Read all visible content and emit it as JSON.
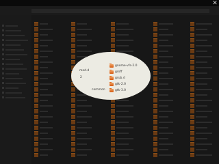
{
  "window": {
    "close_glyph": "✕"
  },
  "spotlight": {
    "folders": [
      {
        "label": "gnome-vfs-2.0"
      },
      {
        "label": "groff"
      },
      {
        "label": "grub.d"
      },
      {
        "label": "gtk-2.0"
      },
      {
        "label": "gtk-3.0"
      }
    ],
    "left_fragments": [
      "mod.d",
      "2",
      "common"
    ]
  },
  "colors": {
    "background": "#141414",
    "spotlight": "#ecebe3",
    "folder_orange": "#e07a2e"
  }
}
